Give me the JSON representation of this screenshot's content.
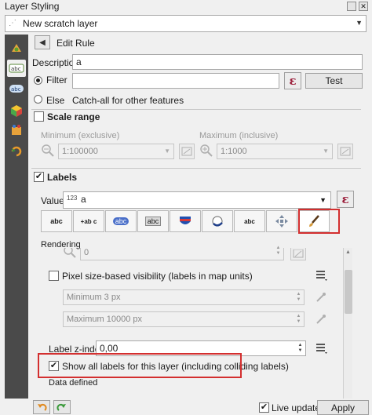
{
  "window": {
    "title": "Layer Styling"
  },
  "layer_combo": {
    "value": "New scratch layer"
  },
  "sidebar": {
    "items": [
      {
        "icon": "paint-icon"
      },
      {
        "icon": "labels-icon",
        "active": true
      },
      {
        "icon": "abc-icon"
      },
      {
        "icon": "cube-3d-icon"
      },
      {
        "icon": "fields-icon"
      },
      {
        "icon": "history-icon"
      }
    ]
  },
  "rule": {
    "header": "Edit Rule",
    "description_label": "Description",
    "description_value": "a",
    "filter_label": "Filter",
    "filter_value": "",
    "expr_symbol": "ε",
    "test_label": "Test",
    "else_label": "Else",
    "else_hint": "Catch-all for other features"
  },
  "scale_range": {
    "label": "Scale range",
    "min_label": "Minimum (exclusive)",
    "min_value": "1:100000",
    "max_label": "Maximum (inclusive)",
    "max_value": "1:1000"
  },
  "labels": {
    "section_label": "Labels",
    "value_label": "Value",
    "value_type": "123",
    "value_text": "a",
    "tabs": [
      "abc",
      "+ab c",
      "abc",
      "abc",
      "",
      "",
      "abc",
      "",
      ""
    ],
    "rendering_label": "Rendering",
    "disabled_spin_value": "0",
    "pixel_size_label": "Pixel size-based visibility (labels in map units)",
    "min_px": "Minimum 3 px",
    "max_px": "Maximum 10000 px",
    "zindex_label": "Label z-index",
    "zindex_value": "0,00",
    "show_all_label": "Show all labels for this layer (including colliding labels)",
    "data_defined_label": "Data defined"
  },
  "bottom": {
    "live_update_label": "Live update",
    "apply_label": "Apply"
  },
  "colors": {
    "highlight": "#d32f2f",
    "sidebar_bg": "#4a4a4a",
    "expr": "#9b1d3a"
  }
}
